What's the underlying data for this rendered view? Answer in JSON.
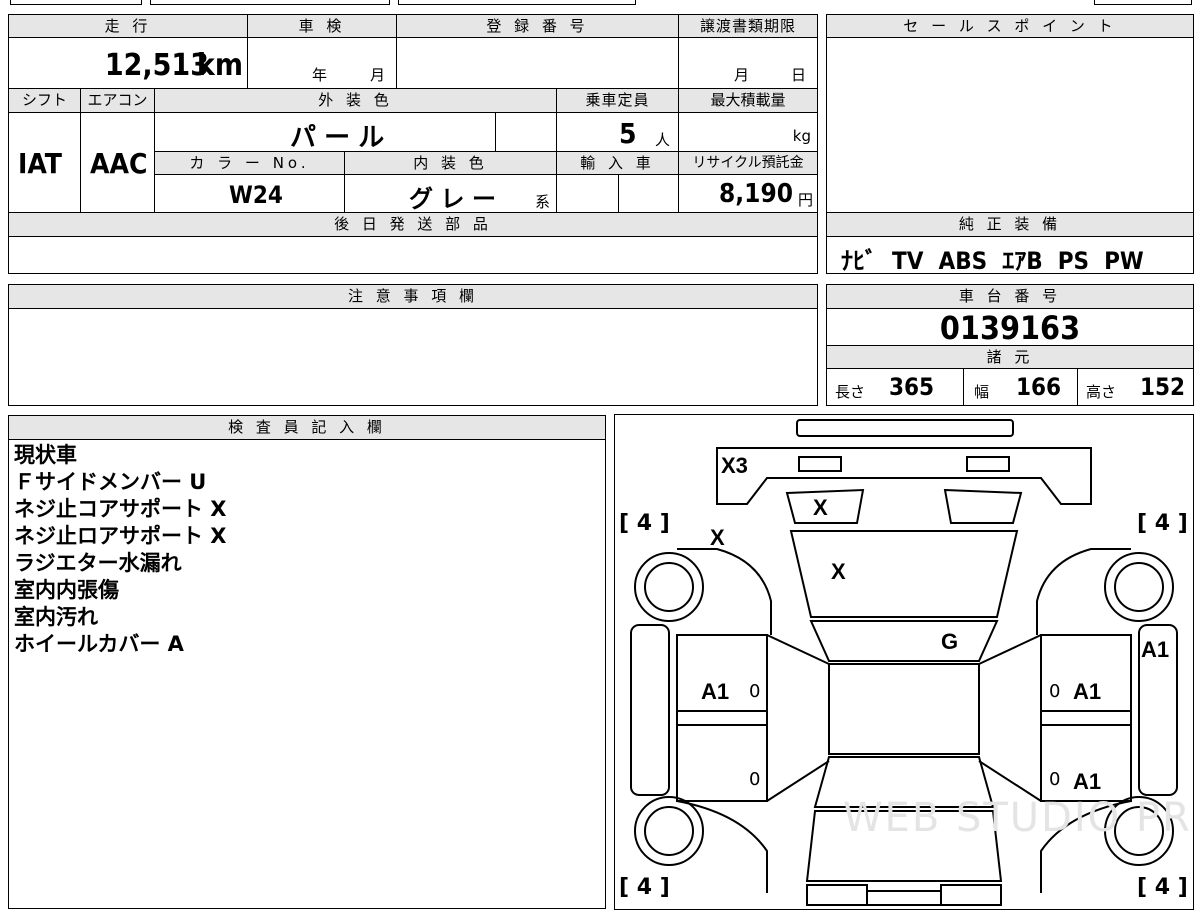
{
  "top_strip": {
    "partial_1": "",
    "partial_2": "",
    "partial_3": "",
    "partial_4": ""
  },
  "main_table": {
    "mileage": {
      "label": "走 行",
      "value": "12,513",
      "unit": "km"
    },
    "inspection": {
      "label": "車 検",
      "year": "年",
      "month": "月"
    },
    "registration": {
      "label": "登 録 番 号",
      "value": ""
    },
    "transfer_deadline": {
      "label": "譲渡書類期限",
      "month": "月",
      "day": "日"
    },
    "shift": {
      "label": "シフト",
      "value": "IAT"
    },
    "aircon": {
      "label": "エアコン",
      "value": "AAC"
    },
    "exterior_color": {
      "label": "外 装 色",
      "value": "パ ー ル"
    },
    "capacity": {
      "label": "乗車定員",
      "value": "5",
      "unit": "人"
    },
    "max_load": {
      "label": "最大積載量",
      "unit": "kg"
    },
    "color_no": {
      "label": "カ ラ ー No.",
      "value": "W24"
    },
    "interior_color": {
      "label": "内 装 色",
      "value": "グ レ ー",
      "suffix": "系"
    },
    "import": {
      "label": "輸 入 車"
    },
    "recycle": {
      "label": "リサイクル預託金",
      "value": "8,190",
      "unit": "円"
    },
    "later_parts": {
      "label": "後 日 発 送 部 品",
      "value": ""
    }
  },
  "sales_point": {
    "label": "セ ー ル ス ポ イ ン ト",
    "value": ""
  },
  "equipment": {
    "label": "純 正 装 備",
    "value": "ﾅﾋﾞ  TV  ABS  ｴｱB  PS  PW"
  },
  "notes_section": {
    "label": "注 意 事 項 欄",
    "value": ""
  },
  "chassis": {
    "label": "車 台 番 号",
    "value": "0139163"
  },
  "specs": {
    "label": "諸 元",
    "length_label": "長さ",
    "length": "365",
    "width_label": "幅",
    "width": "166",
    "height_label": "高さ",
    "height": "152"
  },
  "inspector": {
    "label": "検 査 員 記 入 欄",
    "lines": [
      "現状車",
      "Ｆサイドメンバー U",
      "ネジ止コアサポート X",
      "ネジ止ロアサポート X",
      "ラジエター水漏れ",
      "室内内張傷",
      "室内汚れ",
      "ホイールカバー A"
    ]
  },
  "diagram": {
    "marks": {
      "front_bumper": "X3",
      "left_headlight": "X",
      "hood": "X",
      "left_front_fender": "X",
      "windshield": "G",
      "right_front_door": "A1",
      "right_rear_door": "A1",
      "left_front_door": "A1",
      "right_side": "A1"
    },
    "tires": {
      "fl": "4",
      "fr": "4",
      "rl": "4",
      "rr": "4"
    },
    "zeros": {
      "a": "0",
      "b": "0",
      "c": "0",
      "d": "0"
    },
    "watermark": "WEB STUDIO PRO"
  }
}
